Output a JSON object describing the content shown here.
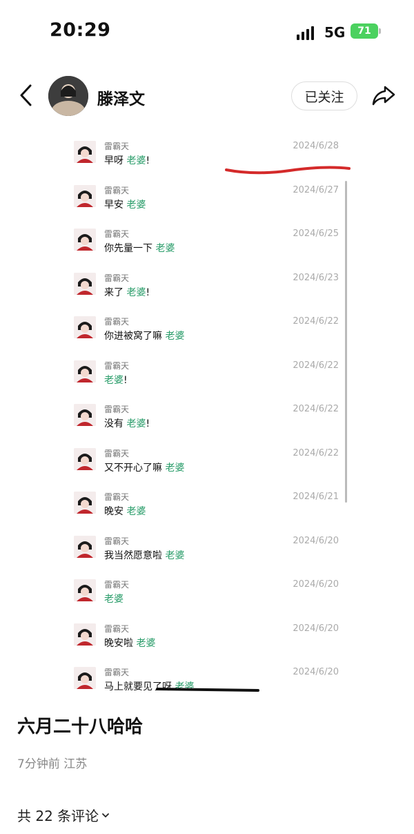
{
  "status_bar": {
    "time": "20:29",
    "network": "5G",
    "battery": "71"
  },
  "header": {
    "name": "滕泽文",
    "follow_label": "已关注"
  },
  "chat": {
    "messages": [
      {
        "sender": "雷霸天",
        "text": "早呀",
        "highlight": "老婆",
        "suffix": "!",
        "date": "2024/6/28"
      },
      {
        "sender": "雷霸天",
        "text": "早安",
        "highlight": "老婆",
        "suffix": "",
        "date": "2024/6/27"
      },
      {
        "sender": "雷霸天",
        "text": "你先量一下",
        "highlight": "老婆",
        "suffix": "",
        "date": "2024/6/25"
      },
      {
        "sender": "雷霸天",
        "text": "来了",
        "highlight": "老婆",
        "suffix": "!",
        "date": "2024/6/23"
      },
      {
        "sender": "雷霸天",
        "text": "你进被窝了嘛",
        "highlight": "老婆",
        "suffix": "",
        "date": "2024/6/22"
      },
      {
        "sender": "雷霸天",
        "text": "",
        "highlight": "老婆",
        "suffix": "!",
        "date": "2024/6/22"
      },
      {
        "sender": "雷霸天",
        "text": "没有",
        "highlight": "老婆",
        "suffix": "!",
        "date": "2024/6/22"
      },
      {
        "sender": "雷霸天",
        "text": "又不开心了嘛",
        "highlight": "老婆",
        "suffix": "",
        "date": "2024/6/22"
      },
      {
        "sender": "雷霸天",
        "text": "晚安",
        "highlight": "老婆",
        "suffix": "",
        "date": "2024/6/21"
      },
      {
        "sender": "雷霸天",
        "text": "我当然愿意啦",
        "highlight": "老婆",
        "suffix": "",
        "date": "2024/6/20"
      },
      {
        "sender": "雷霸天",
        "text": "",
        "highlight": "老婆",
        "suffix": "",
        "date": "2024/6/20"
      },
      {
        "sender": "雷霸天",
        "text": "晚安啦",
        "highlight": "老婆",
        "suffix": "",
        "date": "2024/6/20"
      },
      {
        "sender": "雷霸天",
        "text": "马上就要见了呀",
        "highlight": "老婆",
        "suffix": "",
        "date": "2024/6/20"
      }
    ]
  },
  "post": {
    "title": "六月二十八哈哈",
    "meta": "7分钟前 江苏",
    "comments_label": "共 22 条评论"
  },
  "colors": {
    "accent_green": "#2a9d6a",
    "annotation_red": "#d42a2a",
    "annotation_black": "#111111"
  },
  "icons": [
    "back-icon",
    "share-icon",
    "chevron-down-icon",
    "signal-icon",
    "battery-icon"
  ]
}
